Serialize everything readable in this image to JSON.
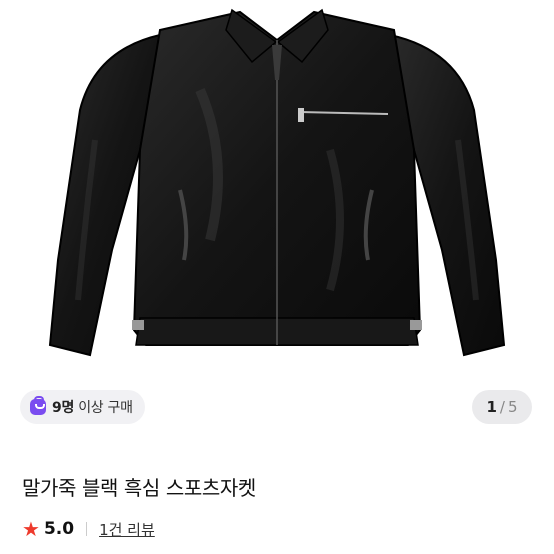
{
  "product": {
    "image_alt": "black leather jacket",
    "buyers_badge": {
      "count": "9명",
      "suffix": "이상 구매",
      "icon": "shopping-bag-icon"
    },
    "pager": {
      "current": "1",
      "separator": "/",
      "total": "5"
    },
    "title": "말가죽 블랙 흑심 스포츠자켓",
    "rating": {
      "score": "5.0",
      "review_link": "1건 리뷰",
      "star_color": "#ee3a2c"
    }
  },
  "colors": {
    "accent": "#7a4cf0",
    "star": "#ee3a2c"
  }
}
